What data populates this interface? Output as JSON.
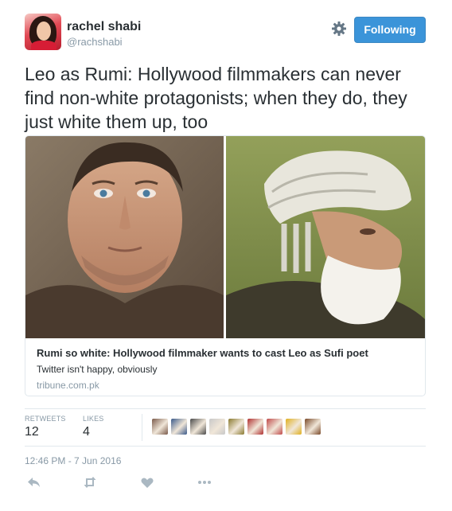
{
  "author": {
    "display_name": "rachel shabi",
    "handle": "@rachshabi"
  },
  "header": {
    "follow_label": "Following",
    "settings_icon": "gear-icon"
  },
  "tweet": {
    "text": "Leo as Rumi: Hollywood filmmakers can never find non-white protagonists; when they do, they just white them up, too"
  },
  "card": {
    "title": "Rumi so white: Hollywood filmmaker wants to cast Leo as Sufi poet",
    "description": "Twitter isn't happy, obviously",
    "domain": "tribune.com.pk"
  },
  "stats": {
    "retweets_label": "RETWEETS",
    "retweets_count": "12",
    "likes_label": "LIKES",
    "likes_count": "4"
  },
  "likers": [
    {
      "color": "#7a5a4a"
    },
    {
      "color": "#3b5a8a"
    },
    {
      "color": "#4a4a4a"
    },
    {
      "color": "#c8c8c8"
    },
    {
      "color": "#8a7a30"
    },
    {
      "color": "#b03030"
    },
    {
      "color": "#c04a4a"
    },
    {
      "color": "#e0b020"
    },
    {
      "color": "#7a4a2a"
    }
  ],
  "timestamp": "12:46 PM - 7 Jun 2016",
  "actions": [
    "reply-icon",
    "retweet-icon",
    "like-icon",
    "more-icon"
  ],
  "colors": {
    "accent": "#3b94d9",
    "text": "#292f33",
    "muted": "#8899a6",
    "border": "#e1e8ed"
  }
}
